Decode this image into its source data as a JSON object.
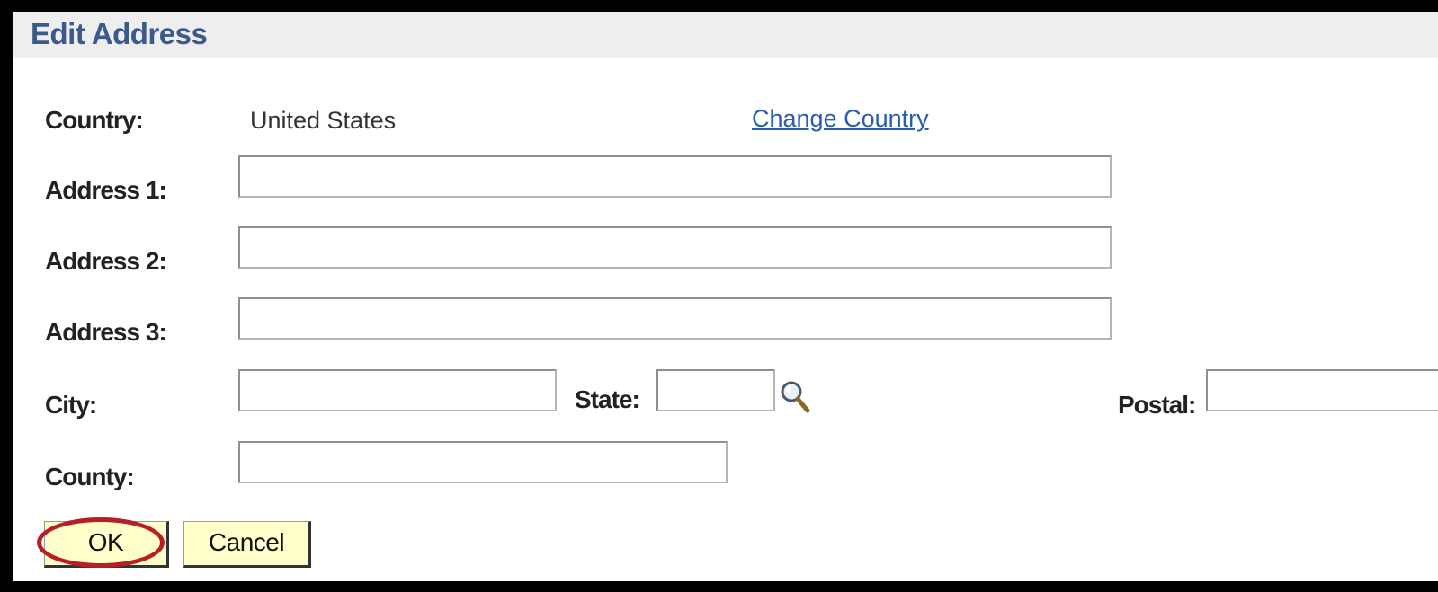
{
  "dialog": {
    "title": "Edit Address"
  },
  "country": {
    "label": "Country:",
    "value": "United States",
    "change_link": "Change Country"
  },
  "address1": {
    "label": "Address 1:",
    "value": ""
  },
  "address2": {
    "label": "Address 2:",
    "value": ""
  },
  "address3": {
    "label": "Address 3:",
    "value": ""
  },
  "city": {
    "label": "City:",
    "value": ""
  },
  "state": {
    "label": "State:",
    "value": "",
    "lookup_icon": "magnifier-lookup-icon"
  },
  "postal": {
    "label": "Postal:",
    "value": ""
  },
  "county": {
    "label": "County:",
    "value": ""
  },
  "buttons": {
    "ok_label": "OK",
    "cancel_label": "Cancel"
  },
  "annotation": {
    "highlight_color": "#b81e25",
    "highlighted_control": "OK"
  },
  "colors": {
    "title": "#3c5a8c",
    "link": "#2a5db0",
    "button_bg": "#ffffcc",
    "header_bg": "#eeeeee"
  }
}
